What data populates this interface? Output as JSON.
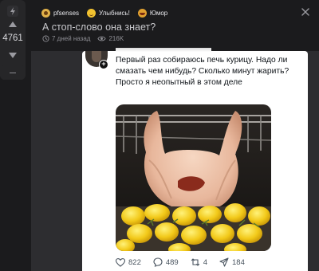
{
  "vote": {
    "count": "4761"
  },
  "header": {
    "tags": [
      {
        "label": "pfsenses",
        "icon": "user-avatar-icon"
      },
      {
        "label": "Улыбнись!",
        "icon": "smile-emoji-icon"
      },
      {
        "label": "Юмор",
        "icon": "laugh-emoji-icon"
      }
    ],
    "title": "А стоп-слово она знает?",
    "time": "7 дней назад",
    "views": "216K"
  },
  "tweet": {
    "text": "Первый раз собираюсь печь курицу. Надо ли смазать чем нибудь? Сколько минут жарить? Просто я неопытный в этом деле",
    "actions": {
      "likes": "822",
      "replies": "489",
      "retweets": "4",
      "shares": "184"
    }
  },
  "colors": {
    "background": "#1b1b1d",
    "panel": "#2d2d30",
    "tweet_bg": "#ffffff",
    "accent": "#f2c230"
  }
}
